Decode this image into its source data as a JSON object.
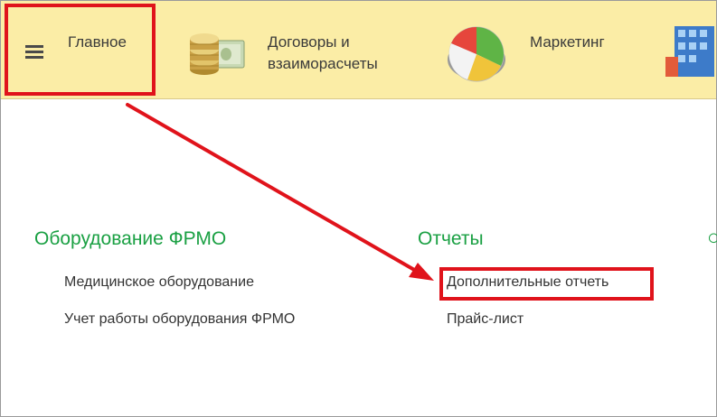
{
  "topbar": {
    "sections": [
      {
        "label": "Главное",
        "icon": "hamburger-menu-icon"
      },
      {
        "label_line1": "Договоры и",
        "label_line2": "взаиморасчеты",
        "icon": "coins-money-icon"
      },
      {
        "label": "Маркетинг",
        "icon": "pie-chart-icon"
      },
      {
        "icon": "building-icon"
      }
    ]
  },
  "groups": [
    {
      "title": "Оборудование ФРМО",
      "links": [
        "Медицинское оборудование",
        "Учет работы оборудования ФРМО"
      ]
    },
    {
      "title": "Отчеты",
      "links": [
        "Дополнительные отчеть",
        "Прайс-лист"
      ]
    }
  ],
  "colors": {
    "topbar_bg": "#fbeda6",
    "group_title": "#1aa043",
    "annotation_red": "#e0131b"
  }
}
